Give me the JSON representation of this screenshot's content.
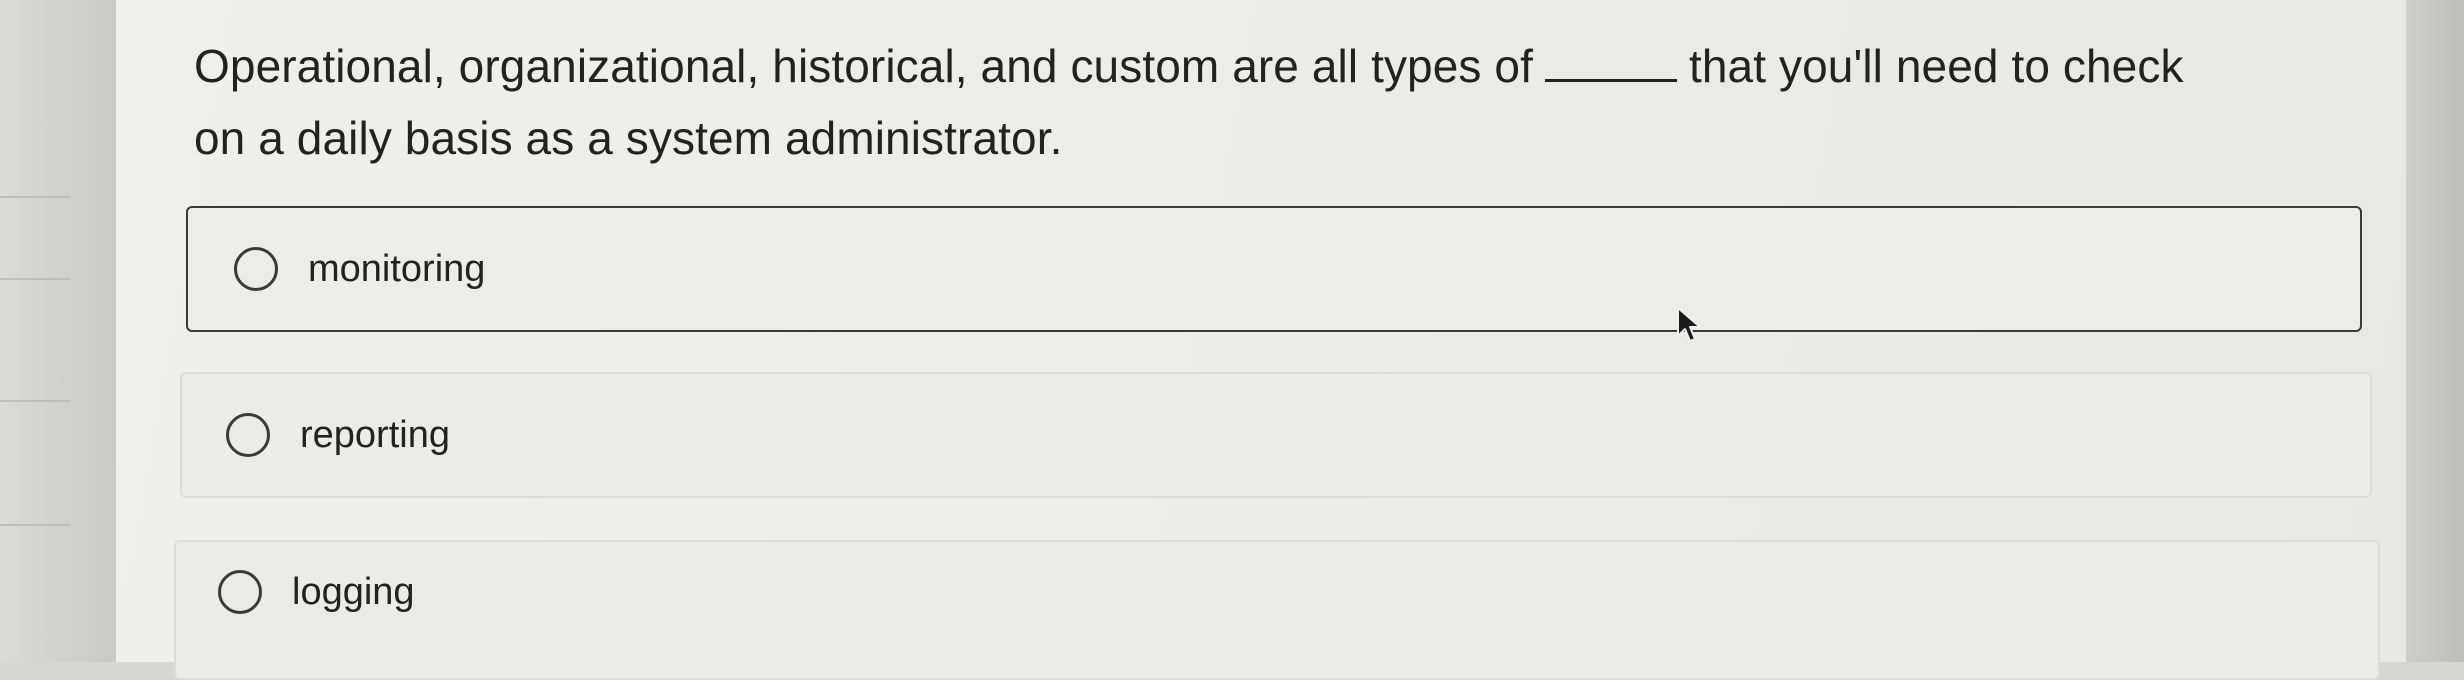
{
  "question": {
    "text_before": "Operational, organizational, historical, and custom are all types of",
    "text_after_line1": "that you'll need to check",
    "text_line2": "on a daily basis as a system administrator."
  },
  "options": [
    {
      "label": "monitoring",
      "state": "hover"
    },
    {
      "label": "reporting",
      "state": "unselected"
    },
    {
      "label": "logging",
      "state": "unselected"
    }
  ],
  "colors": {
    "panel_bg": "#ececea",
    "border_dark": "#3a3a3a",
    "border_light": "#dcdcda",
    "text": "#222222"
  },
  "icons": {
    "radio": "radio-circle-icon",
    "cursor": "mouse-pointer-icon"
  }
}
